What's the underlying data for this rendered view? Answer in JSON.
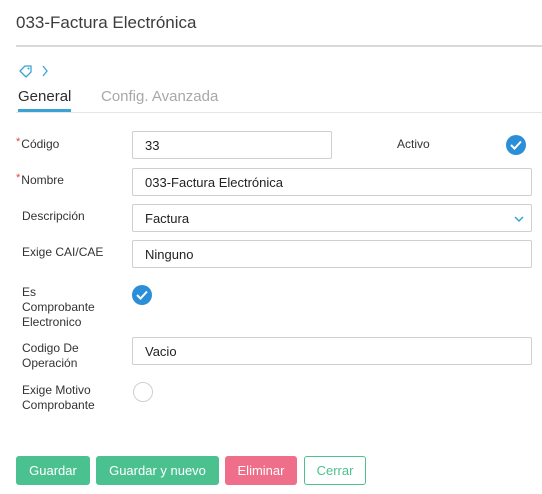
{
  "header": {
    "title": "033-Factura Electrónica"
  },
  "breadcrumb": {
    "tag_icon": "tag-icon",
    "chevron_icon": "chevron-right-icon"
  },
  "tabs": [
    {
      "label": "General",
      "active": true
    },
    {
      "label": "Config. Avanzada",
      "active": false
    }
  ],
  "form": {
    "codigo": {
      "label": "Código",
      "required": "*",
      "value": "33"
    },
    "activo": {
      "label": "Activo",
      "checked": true
    },
    "nombre": {
      "label": "Nombre",
      "required": "*",
      "value": "033-Factura Electrónica"
    },
    "descripcion": {
      "label": "Descripción",
      "value": "Factura"
    },
    "exige_cai": {
      "label": "Exige CAI/CAE",
      "value": "Ninguno"
    },
    "es_comprobante": {
      "label_lines": [
        "Es",
        "Comprobante",
        "Electronico"
      ],
      "checked": true
    },
    "codigo_operacion": {
      "label_lines": [
        "Codigo De",
        "Operación"
      ],
      "value": "Vacio"
    },
    "exige_motivo": {
      "label_lines": [
        "Exige Motivo",
        "Comprobante"
      ],
      "checked": false
    }
  },
  "buttons": {
    "guardar": "Guardar",
    "guardar_nuevo": "Guardar y nuevo",
    "eliminar": "Eliminar",
    "cerrar": "Cerrar"
  },
  "colors": {
    "accent": "#3aa3d6",
    "check": "#2b8fd8",
    "green": "#4cc190",
    "pink": "#ef6e8a",
    "required": "#e0443c"
  }
}
